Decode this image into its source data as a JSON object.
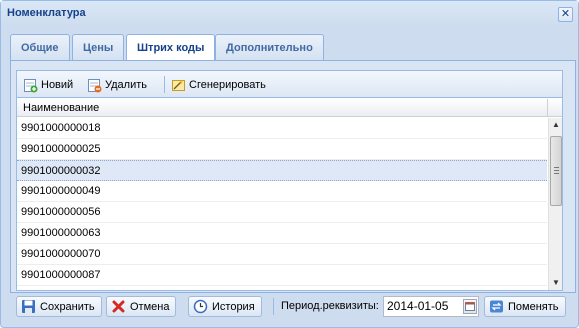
{
  "window": {
    "title": "Номенклатура"
  },
  "tabs": [
    {
      "label": "Общие",
      "active": false
    },
    {
      "label": "Цены",
      "active": false
    },
    {
      "label": "Штрих коды",
      "active": true
    },
    {
      "label": "Дополнительно",
      "active": false
    }
  ],
  "toolbar": {
    "new_label": "Новий",
    "delete_label": "Удалить",
    "generate_label": "Сгенерировать"
  },
  "grid": {
    "column_header": "Наименование",
    "rows": [
      "9901000000018",
      "9901000000025",
      "9901000000032",
      "9901000000049",
      "9901000000056",
      "9901000000063",
      "9901000000070",
      "9901000000087"
    ],
    "selected_index": 2
  },
  "bottom": {
    "save_label": "Сохранить",
    "cancel_label": "Отмена",
    "history_label": "История",
    "period_label": "Период.реквизиты:",
    "period_value": "2014-01-05",
    "change_label": "Поменять"
  },
  "colors": {
    "accent": "#15428b",
    "border": "#99bbe8",
    "selected_row": "#dfe8f6"
  }
}
